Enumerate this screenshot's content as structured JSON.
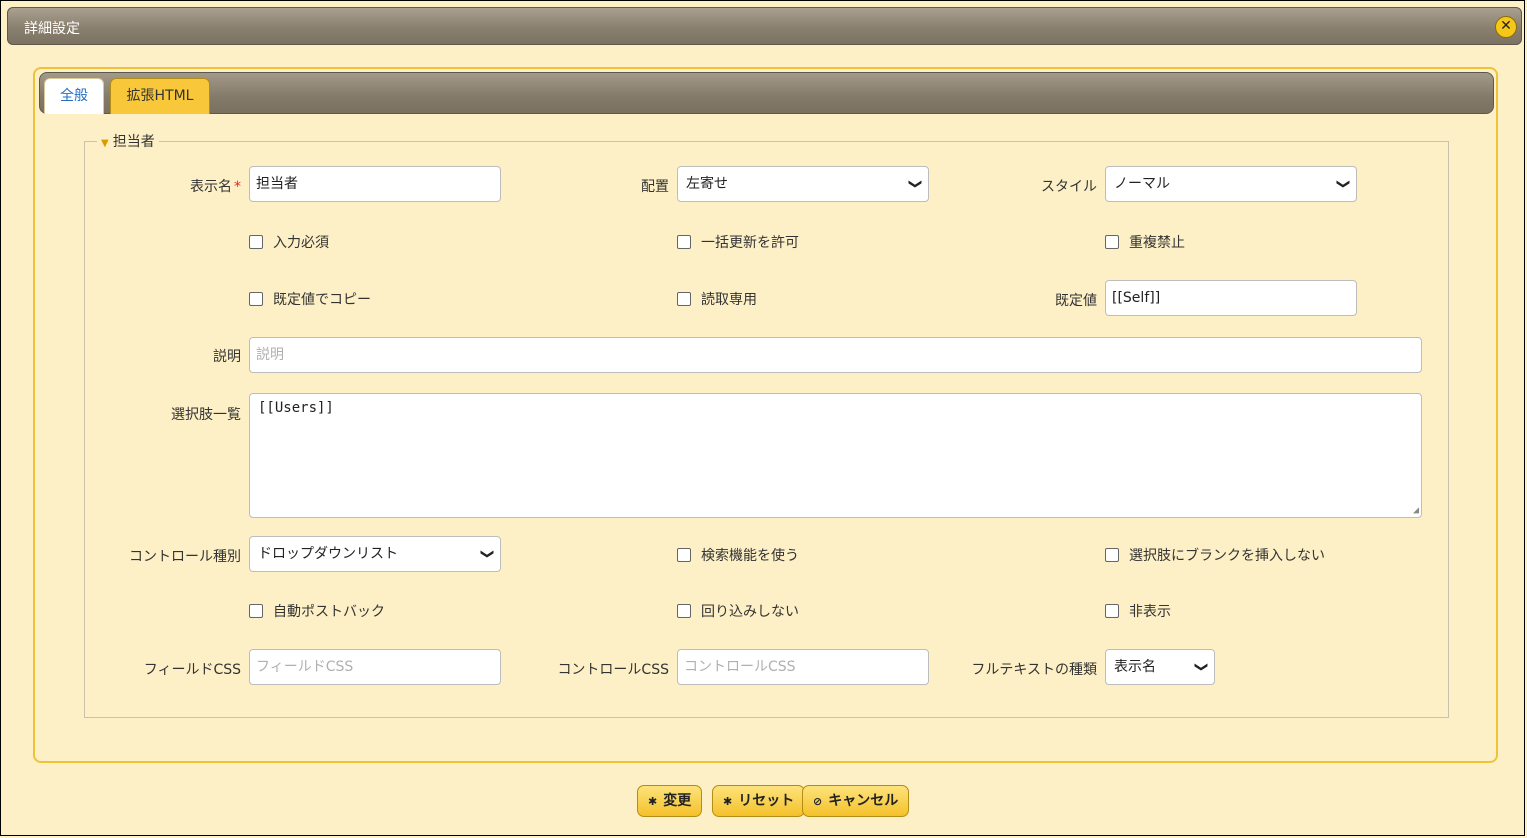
{
  "window": {
    "title": "詳細設定"
  },
  "tabs": [
    {
      "label": "全般"
    },
    {
      "label": "拡張HTML"
    }
  ],
  "section": {
    "legend": "担当者"
  },
  "fields": {
    "display_name": {
      "label": "表示名",
      "required_mark": "*",
      "value": "担当者"
    },
    "alignment": {
      "label": "配置",
      "value": "左寄せ"
    },
    "style": {
      "label": "スタイル",
      "value": "ノーマル"
    },
    "required": {
      "label": "入力必須"
    },
    "bulk_update": {
      "label": "一括更新を許可"
    },
    "no_duplicate": {
      "label": "重複禁止"
    },
    "copy_default": {
      "label": "既定値でコピー"
    },
    "read_only": {
      "label": "読取専用"
    },
    "default_value": {
      "label": "既定値",
      "value": "[[Self]]"
    },
    "description": {
      "label": "説明",
      "placeholder": "説明"
    },
    "choices": {
      "label": "選択肢一覧",
      "value": "[[Users]]"
    },
    "control_type": {
      "label": "コントロール種別",
      "value": "ドロップダウンリスト"
    },
    "use_search": {
      "label": "検索機能を使う"
    },
    "no_blank": {
      "label": "選択肢にブランクを挿入しない"
    },
    "auto_postback": {
      "label": "自動ポストバック"
    },
    "no_wrap": {
      "label": "回り込みしない"
    },
    "hidden": {
      "label": "非表示"
    },
    "field_css": {
      "label": "フィールドCSS",
      "placeholder": "フィールドCSS"
    },
    "control_css": {
      "label": "コントロールCSS",
      "placeholder": "コントロールCSS"
    },
    "fulltext_type": {
      "label": "フルテキストの種類",
      "value": "表示名"
    }
  },
  "buttons": {
    "change": "変更",
    "reset": "リセット",
    "cancel": "キャンセル"
  },
  "colors": {
    "background": "#fdf0c6",
    "accent": "#f4c12a",
    "header": "#8a8070",
    "active_tab_text": "#1f6fc5"
  }
}
